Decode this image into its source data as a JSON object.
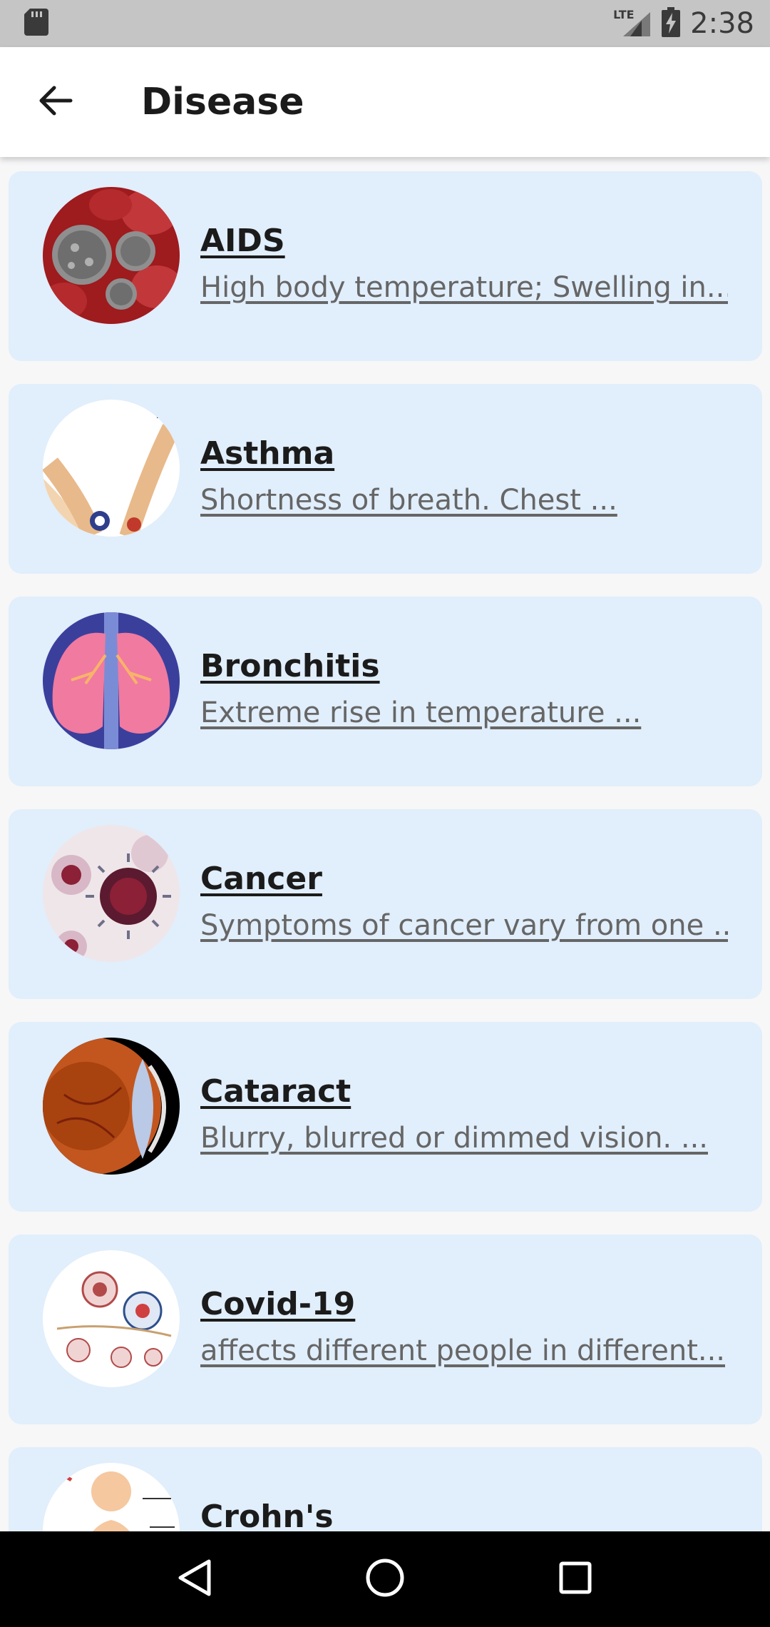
{
  "status_bar": {
    "time": "2:38",
    "network": "LTE"
  },
  "app_bar": {
    "title": "Disease"
  },
  "diseases": [
    {
      "name": "AIDS",
      "description": "High body temperature; Swelling in..."
    },
    {
      "name": "Asthma",
      "description": "Shortness of breath. Chest ..."
    },
    {
      "name": "Bronchitis",
      "description": "Extreme rise in temperature ..."
    },
    {
      "name": "Cancer",
      "description": "Symptoms of cancer vary from one ..."
    },
    {
      "name": "Cataract",
      "description": "Blurry, blurred or dimmed vision. ..."
    },
    {
      "name": "Covid-19",
      "description": "affects different people in different..."
    },
    {
      "name": "Crohn's",
      "description": ""
    }
  ],
  "colors": {
    "card_bg": "#e1eefb",
    "app_bar_bg": "#ffffff",
    "status_bar_bg": "#c5c5c5"
  }
}
